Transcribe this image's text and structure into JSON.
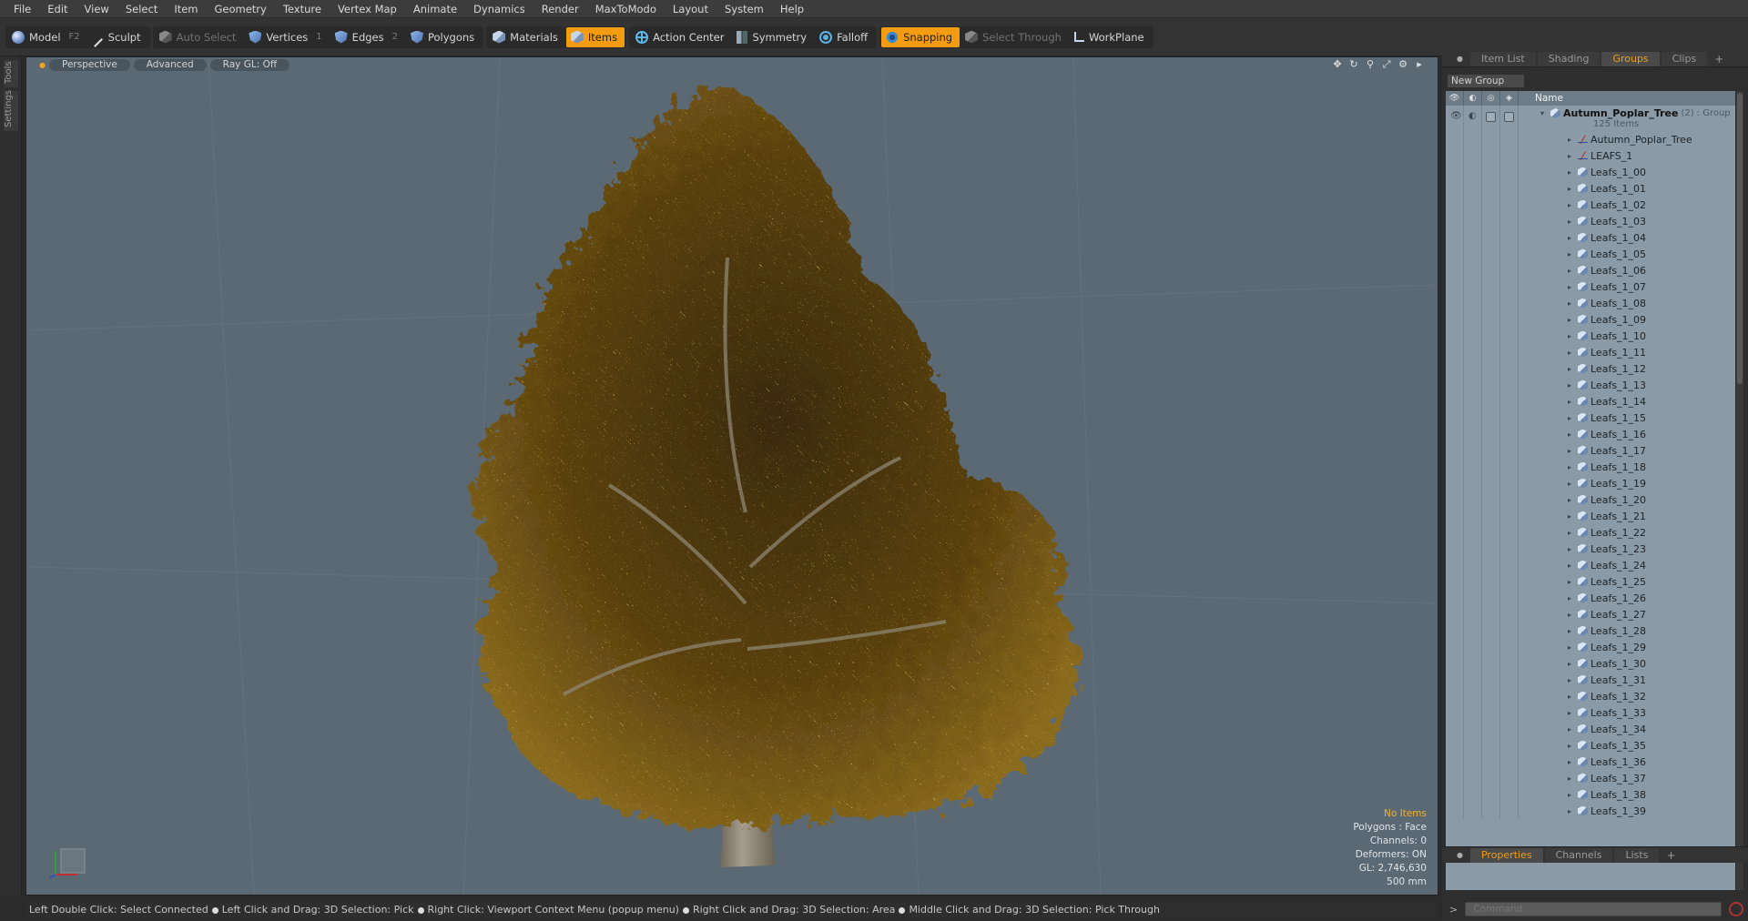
{
  "menubar": {
    "items": [
      "File",
      "Edit",
      "View",
      "Select",
      "Item",
      "Geometry",
      "Texture",
      "Vertex Map",
      "Animate",
      "Dynamics",
      "Render",
      "MaxToModo",
      "Layout",
      "System",
      "Help"
    ]
  },
  "toolbar": {
    "model": "Model",
    "model_key": "F2",
    "sculpt": "Sculpt",
    "auto_select": "Auto Select",
    "vertices": "Vertices",
    "vertices_key": "1",
    "edges": "Edges",
    "edges_key": "2",
    "polygons": "Polygons",
    "materials": "Materials",
    "items": "Items",
    "action_center": "Action Center",
    "symmetry": "Symmetry",
    "falloff": "Falloff",
    "snapping": "Snapping",
    "select_through": "Select Through",
    "workplane": "WorkPlane"
  },
  "left_tabs": {
    "tools": "Tools",
    "settings": "Settings"
  },
  "viewport": {
    "view_mode": "Perspective",
    "shading": "Advanced",
    "raygl": "Ray GL: Off",
    "info": {
      "selection": "No Items",
      "polygons": "Polygons : Face",
      "channels": "Channels: 0",
      "deformers": "Deformers: ON",
      "gl": "GL: 2,746,630",
      "scale": "500 mm"
    },
    "colors": {
      "background": "#5b6974",
      "foliage": "#6b4e12",
      "highlight": "#f0b030"
    }
  },
  "statusbar": {
    "hints": [
      "Left Double Click: Select Connected",
      "Left Click and Drag: 3D Selection: Pick",
      "Right Click: Viewport Context Menu (popup menu)",
      "Right Click and Drag: 3D Selection: Area",
      "Middle Click and Drag: 3D Selection: Pick Through"
    ]
  },
  "right_panel": {
    "tabs": [
      "Item List",
      "Shading",
      "Groups",
      "Clips"
    ],
    "active_tab": "Groups",
    "new_group": "New Group",
    "name_header": "Name",
    "group": {
      "name": "Autumn_Poplar_Tree",
      "count": "(2)",
      "type": ": Group",
      "sub": "125 Items"
    },
    "items": [
      {
        "name": "Autumn_Poplar_Tree",
        "icon": "locator-icon"
      },
      {
        "name": "LEAFS_1",
        "icon": "locator-icon"
      },
      {
        "name": "Leafs_1_00",
        "icon": "mesh-icon"
      },
      {
        "name": "Leafs_1_01",
        "icon": "mesh-icon"
      },
      {
        "name": "Leafs_1_02",
        "icon": "mesh-icon"
      },
      {
        "name": "Leafs_1_03",
        "icon": "mesh-icon"
      },
      {
        "name": "Leafs_1_04",
        "icon": "mesh-icon"
      },
      {
        "name": "Leafs_1_05",
        "icon": "mesh-icon"
      },
      {
        "name": "Leafs_1_06",
        "icon": "mesh-icon"
      },
      {
        "name": "Leafs_1_07",
        "icon": "mesh-icon"
      },
      {
        "name": "Leafs_1_08",
        "icon": "mesh-icon"
      },
      {
        "name": "Leafs_1_09",
        "icon": "mesh-icon"
      },
      {
        "name": "Leafs_1_10",
        "icon": "mesh-icon"
      },
      {
        "name": "Leafs_1_11",
        "icon": "mesh-icon"
      },
      {
        "name": "Leafs_1_12",
        "icon": "mesh-icon"
      },
      {
        "name": "Leafs_1_13",
        "icon": "mesh-icon"
      },
      {
        "name": "Leafs_1_14",
        "icon": "mesh-icon"
      },
      {
        "name": "Leafs_1_15",
        "icon": "mesh-icon"
      },
      {
        "name": "Leafs_1_16",
        "icon": "mesh-icon"
      },
      {
        "name": "Leafs_1_17",
        "icon": "mesh-icon"
      },
      {
        "name": "Leafs_1_18",
        "icon": "mesh-icon"
      },
      {
        "name": "Leafs_1_19",
        "icon": "mesh-icon"
      },
      {
        "name": "Leafs_1_20",
        "icon": "mesh-icon"
      },
      {
        "name": "Leafs_1_21",
        "icon": "mesh-icon"
      },
      {
        "name": "Leafs_1_22",
        "icon": "mesh-icon"
      },
      {
        "name": "Leafs_1_23",
        "icon": "mesh-icon"
      },
      {
        "name": "Leafs_1_24",
        "icon": "mesh-icon"
      },
      {
        "name": "Leafs_1_25",
        "icon": "mesh-icon"
      },
      {
        "name": "Leafs_1_26",
        "icon": "mesh-icon"
      },
      {
        "name": "Leafs_1_27",
        "icon": "mesh-icon"
      },
      {
        "name": "Leafs_1_28",
        "icon": "mesh-icon"
      },
      {
        "name": "Leafs_1_29",
        "icon": "mesh-icon"
      },
      {
        "name": "Leafs_1_30",
        "icon": "mesh-icon"
      },
      {
        "name": "Leafs_1_31",
        "icon": "mesh-icon"
      },
      {
        "name": "Leafs_1_32",
        "icon": "mesh-icon"
      },
      {
        "name": "Leafs_1_33",
        "icon": "mesh-icon"
      },
      {
        "name": "Leafs_1_34",
        "icon": "mesh-icon"
      },
      {
        "name": "Leafs_1_35",
        "icon": "mesh-icon"
      },
      {
        "name": "Leafs_1_36",
        "icon": "mesh-icon"
      },
      {
        "name": "Leafs_1_37",
        "icon": "mesh-icon"
      },
      {
        "name": "Leafs_1_38",
        "icon": "mesh-icon"
      },
      {
        "name": "Leafs_1_39",
        "icon": "mesh-icon"
      }
    ],
    "bottom_tabs": [
      "Properties",
      "Channels",
      "Lists"
    ],
    "bottom_active": "Properties",
    "command_placeholder": "Command"
  }
}
